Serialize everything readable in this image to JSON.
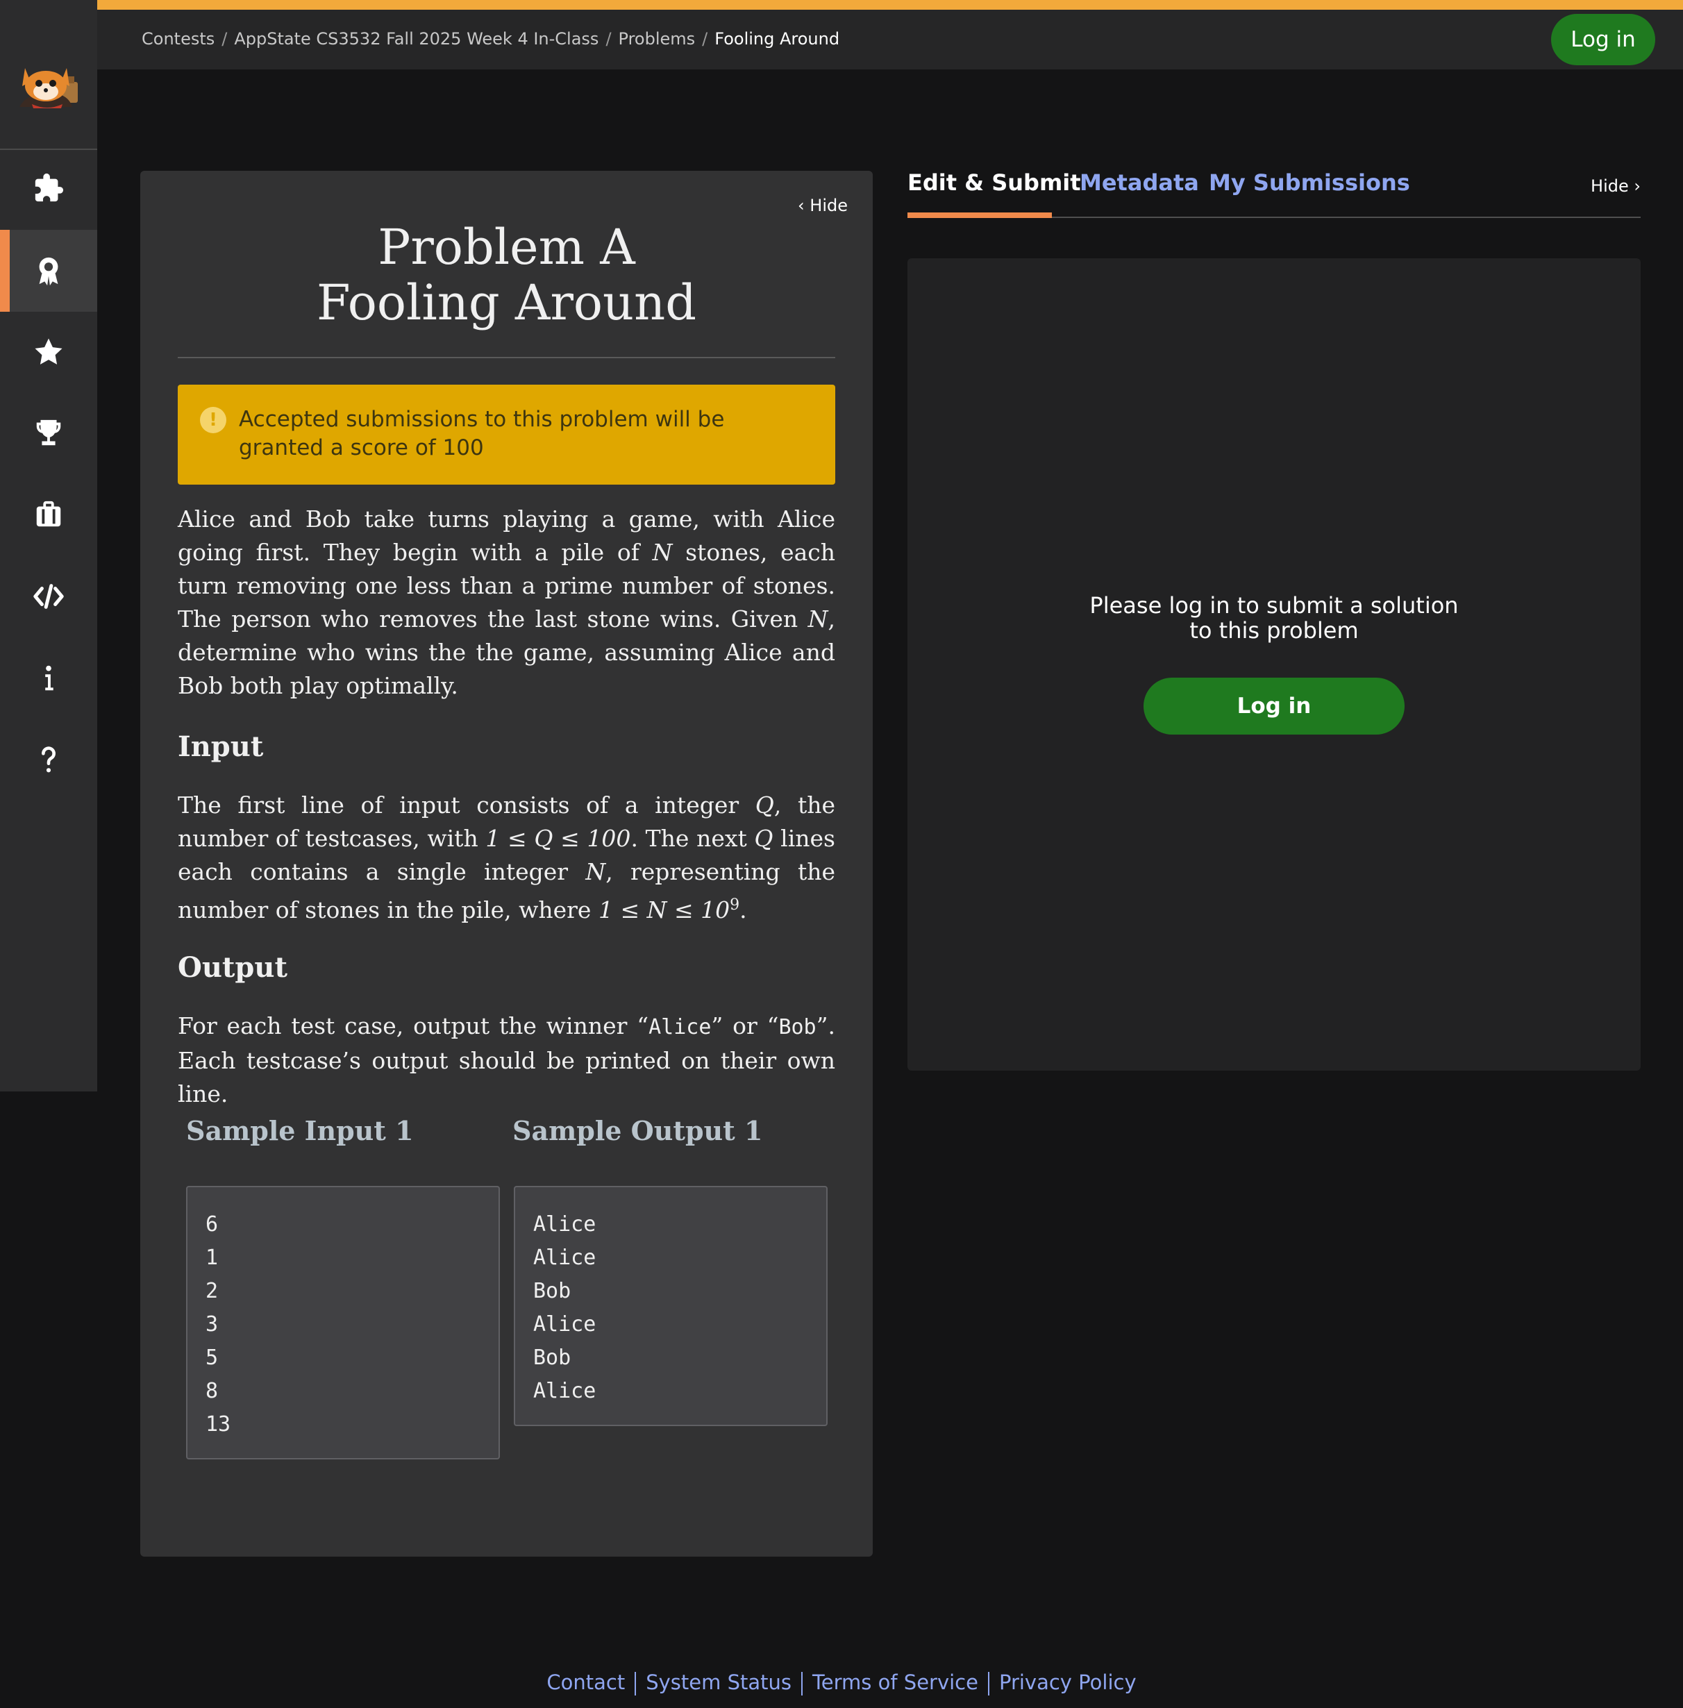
{
  "breadcrumb": {
    "items": [
      "Contests",
      "AppState CS3532 Fall 2025 Week 4 In-Class",
      "Problems"
    ],
    "current": "Fooling Around"
  },
  "header": {
    "login_label": "Log in"
  },
  "sidebar": {
    "icons": [
      "puzzle-icon",
      "badge-icon",
      "star-icon",
      "trophy-icon",
      "briefcase-icon",
      "code-icon",
      "info-icon",
      "question-icon"
    ],
    "active_index": 1
  },
  "problem": {
    "hide_label": "Hide",
    "title_line1": "Problem A",
    "title_line2": "Fooling Around",
    "alert": "Accepted submissions to this problem will be granted a score of 100",
    "statement": {
      "t1": "Alice and Bob take turns playing a game, with Alice going first. They begin with a pile of ",
      "v1": "N",
      "t2": " stones, each turn removing one less than a prime number of stones. The person who removes the last stone wins. Given ",
      "v2": "N",
      "t3": ", determine who wins the the game, assuming Alice and Bob both play optimally."
    },
    "input_heading": "Input",
    "input": {
      "t1": "The first line of input consists of a integer ",
      "v1": "Q",
      "t2": ", the number of testcases, with ",
      "m1": "1 ≤ Q ≤ 100",
      "t3": ". The next ",
      "v2": "Q",
      "t4": " lines each contains a single integer ",
      "v3": "N",
      "t5": ", representing the number of stones in the pile, where ",
      "m2": "1 ≤ N ≤ 10",
      "m2sup": "9",
      "t6": "."
    },
    "output_heading": "Output",
    "output": {
      "t1": "For each test case, output the winner “",
      "c1": "Alice",
      "t2": "” or “",
      "c2": "Bob",
      "t3": "”. Each testcase’s output should be printed on their own line."
    },
    "sample_input_heading": "Sample Input 1",
    "sample_output_heading": "Sample Output 1",
    "sample_input": "6\n1\n2\n3\n5\n8\n13",
    "sample_output": "Alice\nAlice\nBob\nAlice\nBob\nAlice"
  },
  "tabs": [
    {
      "label": "Edit & Submit",
      "active": true
    },
    {
      "label": "Metadata",
      "active": false
    },
    {
      "label": "My Submissions",
      "active": false
    }
  ],
  "right": {
    "hide_label": "Hide",
    "login_message": "Please log in to submit a solution to this problem",
    "login_label": "Log in"
  },
  "footer": {
    "links": [
      "Contact",
      "System Status",
      "Terms of Service",
      "Privacy Policy"
    ]
  },
  "colors": {
    "accent": "#f2a93b",
    "active_tab": "#f08a4b",
    "login_green": "#1f7a1f",
    "link": "#8fa6f0",
    "alert": "#dfa700"
  }
}
